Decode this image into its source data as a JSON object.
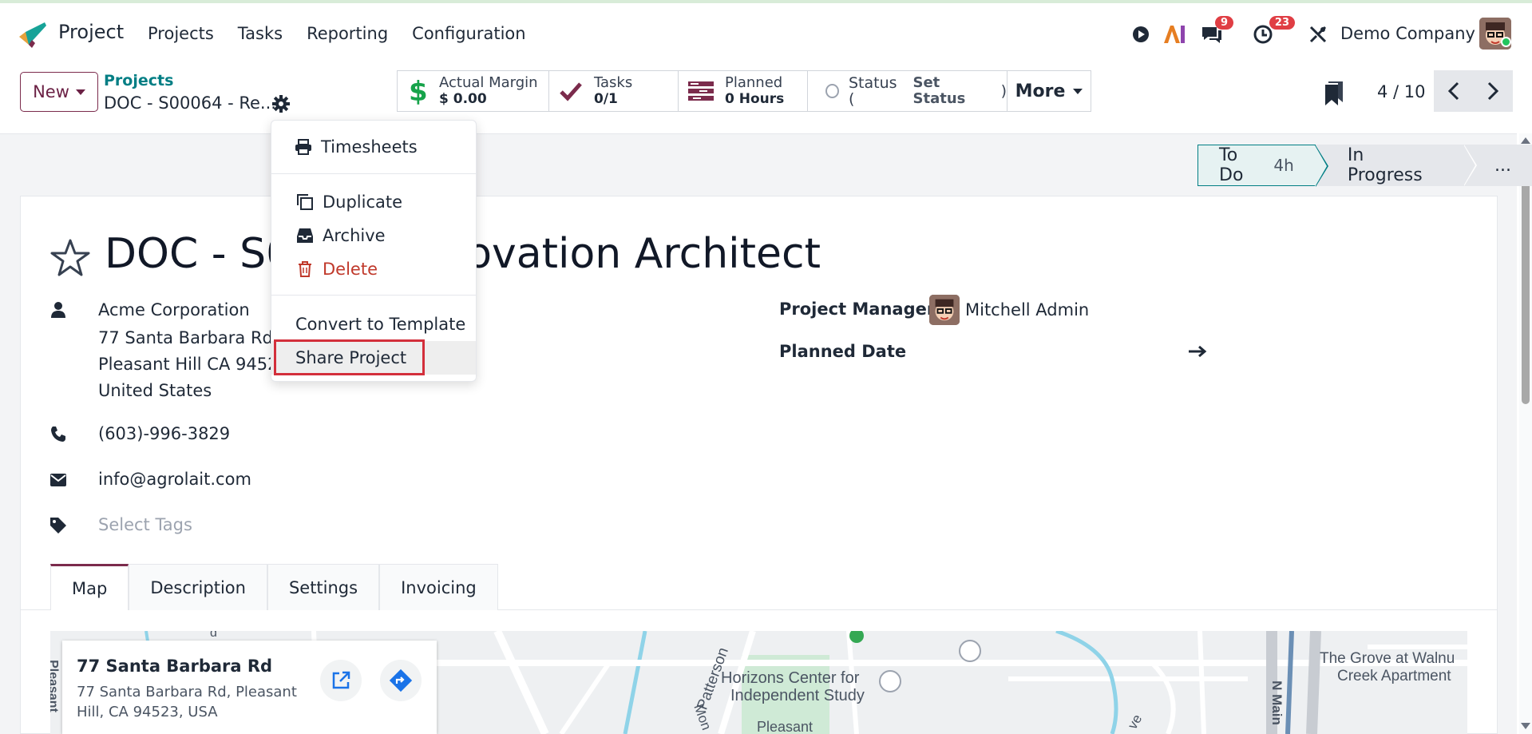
{
  "navbar": {
    "app_name": "Project",
    "menu": [
      "Projects",
      "Tasks",
      "Reporting",
      "Configuration"
    ],
    "ai_label": "AI",
    "messages_count": "9",
    "activities_count": "23",
    "company": "Demo Company"
  },
  "control": {
    "new_label": "New",
    "breadcrumb_parent": "Projects",
    "breadcrumb_current": "DOC - S00064 - Re...",
    "smart_buttons": {
      "margin_label": "Actual Margin",
      "margin_value": "$ 0.00",
      "tasks_label": "Tasks",
      "tasks_value": "0/1",
      "planned_label": "Planned",
      "planned_value": "0 Hours",
      "status_prefix": "Status (",
      "status_value": "Set Status",
      "status_suffix": ")",
      "more_label": "More"
    },
    "pager": "4 / 10"
  },
  "stages": {
    "todo": "To Do",
    "todo_hours": "4h",
    "in_progress": "In Progress",
    "more": "..."
  },
  "form": {
    "title_left": "DOC - S0",
    "title_right": "ovation Architect",
    "customer": "Acme Corporation",
    "address_line1": "77 Santa Barbara Rd",
    "address_line2": "Pleasant Hill CA 94523",
    "address_line3": "United States",
    "phone": "(603)-996-3829",
    "email": "info@agrolait.com",
    "tags_placeholder": "Select Tags",
    "project_manager_label": "Project Manager",
    "project_manager": "Mitchell Admin",
    "planned_date_label": "Planned Date"
  },
  "tabs": [
    "Map",
    "Description",
    "Settings",
    "Invoicing"
  ],
  "map": {
    "card_title": "77 Santa Barbara Rd",
    "card_address": "77 Santa Barbara Rd, Pleasant Hill, CA 94523, USA",
    "labels": {
      "patterson": "Patterson",
      "horizons": "Horizons Center for",
      "independent": "Independent Study",
      "grove": "The Grove at Walnu",
      "creek": "Creek Apartment",
      "n_main": "N Main",
      "pleasant_side": "Pleasant",
      "pleasant_bottom": "Pleasant",
      "mon": "Mon",
      "ve": "ve",
      "d_side": "d"
    }
  },
  "dropdown": {
    "timesheets": "Timesheets",
    "duplicate": "Duplicate",
    "archive": "Archive",
    "delete": "Delete",
    "convert": "Convert to Template",
    "share": "Share Project"
  },
  "colors": {
    "brand": "#7b2b4c",
    "teal": "#017e84",
    "danger": "#d32f3b"
  }
}
